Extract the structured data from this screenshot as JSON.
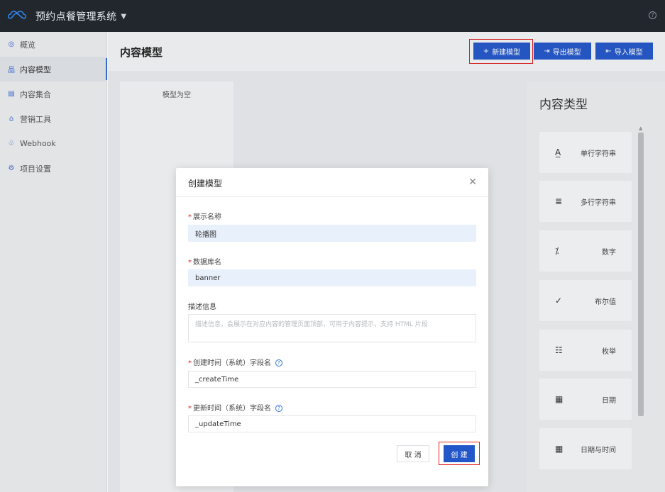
{
  "app": {
    "title": "预约点餐管理系统"
  },
  "sidebar": {
    "items": [
      {
        "label": "概览",
        "icon": "eye-icon",
        "glyph": "◎"
      },
      {
        "label": "内容模型",
        "icon": "model-tree-icon",
        "glyph": "品"
      },
      {
        "label": "内容集合",
        "icon": "collection-icon",
        "glyph": "▤"
      },
      {
        "label": "营销工具",
        "icon": "shopping-bag-icon",
        "glyph": "⌂"
      },
      {
        "label": "Webhook",
        "icon": "webhook-icon",
        "glyph": "♧"
      },
      {
        "label": "项目设置",
        "icon": "gear-icon",
        "glyph": "⚙"
      }
    ]
  },
  "header": {
    "title": "内容模型",
    "new_model_label": "新建模型",
    "export_model_label": "导出模型",
    "import_model_label": "导入模型"
  },
  "model_list": {
    "empty_text": "模型为空"
  },
  "types_panel": {
    "title": "内容类型",
    "types": [
      {
        "label": "单行字符串",
        "glyph": "A̲"
      },
      {
        "label": "多行字符串",
        "glyph": "≣"
      },
      {
        "label": "数字",
        "glyph": "⁒"
      },
      {
        "label": "布尔值",
        "glyph": "✓"
      },
      {
        "label": "枚举",
        "glyph": "☷"
      },
      {
        "label": "日期",
        "glyph": "▦"
      },
      {
        "label": "日期与时间",
        "glyph": "▦"
      }
    ]
  },
  "modal": {
    "title": "创建模型",
    "close_glyph": "✕",
    "fields": {
      "display_name": {
        "label": "展示名称",
        "value": "轮播图"
      },
      "db_name": {
        "label": "数据库名",
        "value": "banner"
      },
      "description": {
        "label": "描述信息",
        "placeholder": "描述信息，会展示在对应内容的管理页面顶部，可用于内容提示，支持 HTML 片段"
      },
      "create_time": {
        "label": "创建时间（系统）字段名",
        "value": "_createTime"
      },
      "update_time": {
        "label": "更新时间（系统）字段名",
        "value": "_updateTime"
      }
    },
    "cancel_label": "取 消",
    "create_label": "创 建"
  },
  "colors": {
    "topbar": "#22272e",
    "primary": "#2357c9",
    "highlight": "#e02020",
    "required": "#e02020"
  }
}
